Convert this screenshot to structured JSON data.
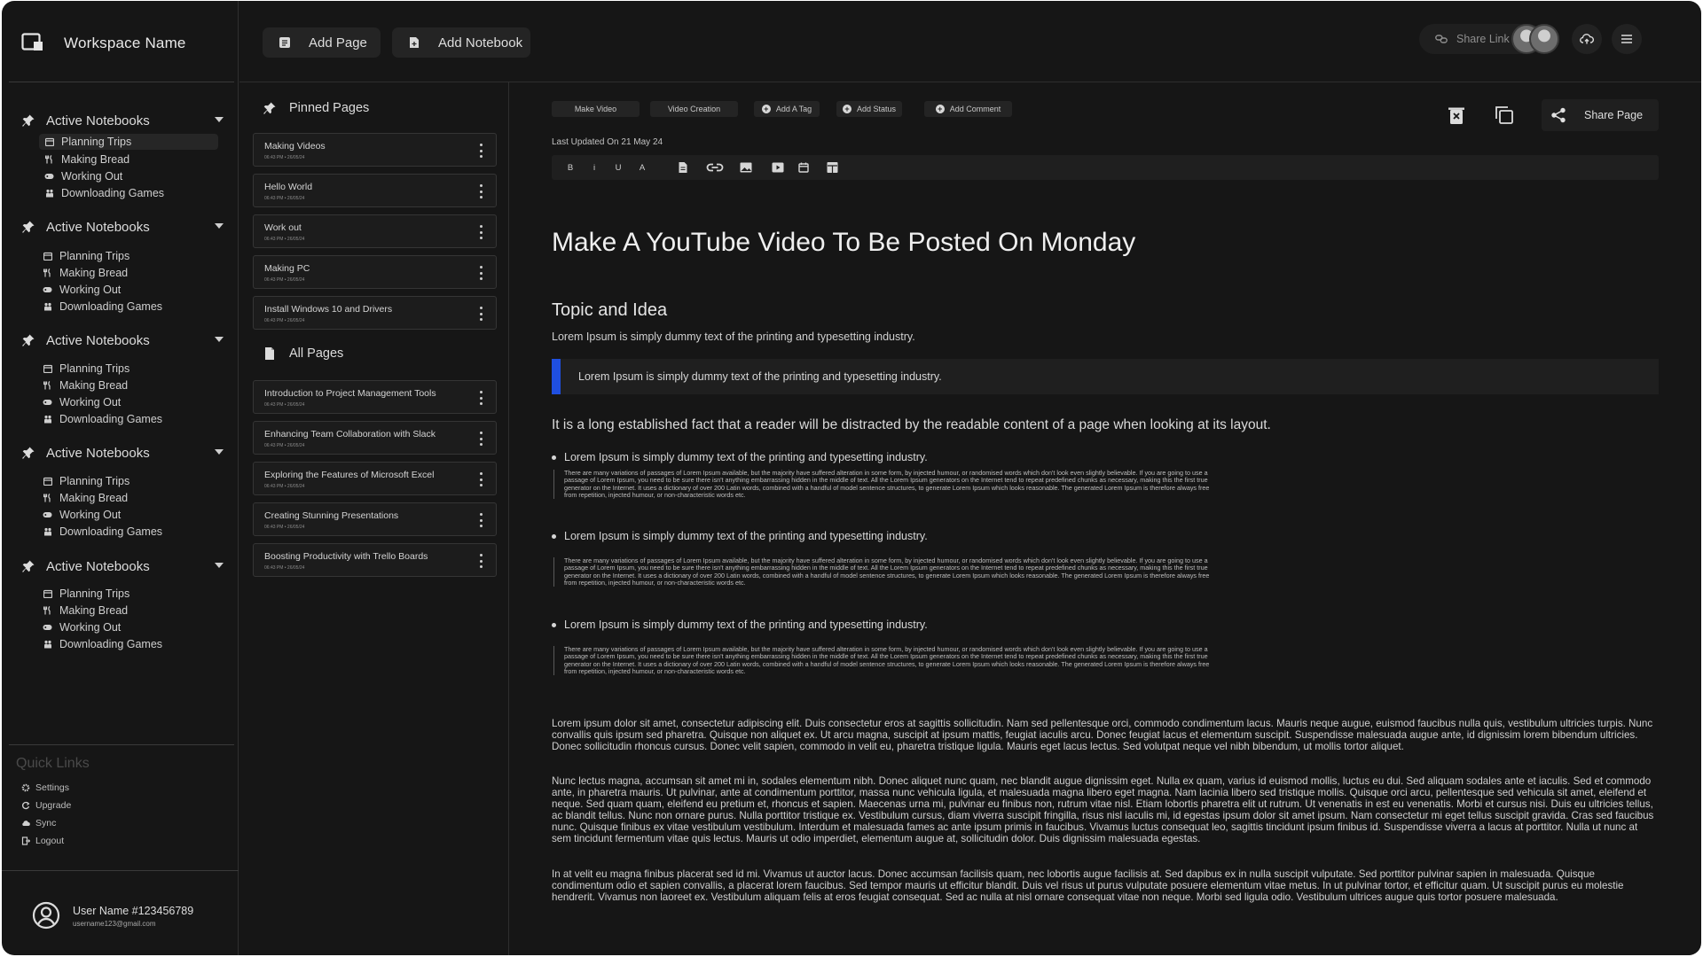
{
  "workspace": {
    "name": "Workspace Name"
  },
  "toolbar": {
    "add_page": "Add Page",
    "add_notebook": "Add Notebook",
    "share_link": "Share Link"
  },
  "sidebar": {
    "groups": [
      {
        "title": "Active Notebooks",
        "items": [
          "Planning Trips",
          "Making Bread",
          "Working Out",
          "Downloading Games"
        ]
      },
      {
        "title": "Active Notebooks",
        "items": [
          "Planning Trips",
          "Making Bread",
          "Working Out",
          "Downloading Games"
        ]
      },
      {
        "title": "Active Notebooks",
        "items": [
          "Planning Trips",
          "Making Bread",
          "Working Out",
          "Downloading Games"
        ]
      },
      {
        "title": "Active Notebooks",
        "items": [
          "Planning Trips",
          "Making Bread",
          "Working Out",
          "Downloading Games"
        ]
      },
      {
        "title": "Active Notebooks",
        "items": [
          "Planning Trips",
          "Making Bread",
          "Working Out",
          "Downloading Games"
        ]
      }
    ],
    "quick_links": {
      "title": "Quick Links",
      "items": [
        "Settings",
        "Upgrade",
        "Sync",
        "Logout"
      ]
    },
    "user": {
      "name": "User Name #123456789",
      "email": "username123@gmail.com"
    }
  },
  "pages": {
    "pinned_title": "Pinned Pages",
    "pinned": [
      {
        "title": "Making Videos",
        "date": "06:43 PM  •  26/05/24"
      },
      {
        "title": "Hello World",
        "date": "06:43 PM  •  26/05/24"
      },
      {
        "title": "Work out",
        "date": "06:43 PM  •  26/05/24"
      },
      {
        "title": "Making PC",
        "date": "06:43 PM  •  26/05/24"
      },
      {
        "title": "Install Windows 10 and Drivers",
        "date": "06:43 PM  •  26/05/24"
      }
    ],
    "all_title": "All Pages",
    "all": [
      {
        "title": "Introduction to Project Management Tools",
        "date": "06:43 PM  •  26/05/24"
      },
      {
        "title": "Enhancing Team Collaboration with Slack",
        "date": "06:43 PM  •  26/05/24"
      },
      {
        "title": "Exploring the Features of Microsoft Excel",
        "date": "06:43 PM  •  26/05/24"
      },
      {
        "title": "Creating Stunning Presentations",
        "date": "06:43 PM  •  26/05/24"
      },
      {
        "title": "Boosting Productivity with Trello Boards",
        "date": "06:43 PM  •  26/05/24"
      }
    ]
  },
  "editor": {
    "tags": [
      "Make Video",
      "Video Creation"
    ],
    "add_tag": "Add A Tag",
    "add_status": "Add Status",
    "add_comment": "Add Comment",
    "share_page": "Share Page",
    "last_updated": "Last Updated On 21 May 24",
    "format": {
      "bold": "B",
      "italic": "i",
      "underline": "U",
      "color": "A"
    },
    "accent": "#1f4fe0"
  },
  "document": {
    "title": "Make A YouTube Video To Be Posted On Monday",
    "heading": "Topic and Idea",
    "intro": "Lorem Ipsum is simply dummy text of the printing and typesetting industry.",
    "quote": "Lorem Ipsum is simply dummy text of the printing and typesetting industry.",
    "lead": "It is a long established fact that a reader will be distracted by the readable content of a page when looking at its layout.",
    "bullets": [
      "Lorem Ipsum is simply dummy text of the printing and typesetting industry.",
      "Lorem Ipsum is simply dummy text of the printing and typesetting industry.",
      "Lorem Ipsum is simply dummy text of the printing and typesetting industry."
    ],
    "small_text": "There are many variations of passages of Lorem Ipsum available, but the majority have suffered alteration in some form, by injected humour, or randomised words which don't look even slightly believable. If you are going to use a passage of Lorem Ipsum, you need to be sure there isn't anything embarrassing hidden in the middle of text. All the Lorem Ipsum generators on the Internet tend to repeat predefined chunks as necessary, making this the first true generator on the Internet. It uses a dictionary of over 200 Latin words, combined with a handful of model sentence structures, to generate Lorem Ipsum which looks reasonable. The generated Lorem Ipsum is therefore always free from repetition, injected humour, or non-characteristic words etc.",
    "paragraphs": [
      "Lorem ipsum dolor sit amet, consectetur adipiscing elit. Duis consectetur eros at sagittis sollicitudin. Nam sed pellentesque orci, commodo condimentum lacus. Mauris neque augue, euismod faucibus nulla quis, vestibulum ultricies turpis. Nunc convallis quis ipsum sed pharetra. Quisque non aliquet ex. Ut arcu magna, suscipit at ipsum mattis, feugiat iaculis arcu. Donec feugiat lacus et elementum suscipit. Suspendisse malesuada augue ante, id dignissim lorem bibendum ultricies. Donec sollicitudin rhoncus cursus. Donec velit sapien, commodo in velit eu, pharetra tristique ligula. Mauris eget lacus lectus. Sed volutpat neque vel nibh bibendum, ut mollis tortor aliquet.",
      "Nunc lectus magna, accumsan sit amet mi in, sodales elementum nibh. Donec aliquet nunc quam, nec blandit augue dignissim eget. Nulla ex quam, varius id euismod mollis, luctus eu dui. Sed aliquam sodales ante et iaculis. Sed et commodo ante, in pharetra mauris. Ut pulvinar, ante at condimentum porttitor, massa nunc vehicula ligula, et malesuada magna libero eget magna. Nam lacinia libero sed tristique mollis. Quisque orci arcu, pellentesque sed vehicula sit amet, eleifend et neque. Sed quam quam, eleifend eu pretium et, rhoncus et sapien. Maecenas urna mi, pulvinar eu finibus non, rutrum vitae nisl. Etiam lobortis pharetra elit ut rutrum. Ut venenatis in est eu venenatis. Morbi et cursus nisi. Duis eu ultricies tellus, ac blandit tellus. Nunc non ornare purus. Nulla porttitor tristique ex. Vestibulum cursus, diam viverra suscipit fringilla, risus nisl iaculis mi, id egestas ipsum dolor sit amet ipsum. Nam consectetur mi eget tellus suscipit gravida. Cras sed faucibus nunc. Quisque finibus ex vitae vestibulum vestibulum. Interdum et malesuada fames ac ante ipsum primis in faucibus. Vivamus luctus consequat leo, sagittis tincidunt ipsum finibus id. Suspendisse viverra a lacus at porttitor. Nulla ut nunc at sem tincidunt fermentum vitae quis lectus. Mauris ut odio imperdiet, elementum augue at, sollicitudin dolor. Duis dignissim malesuada egestas.",
      "In at velit eu magna finibus placerat sed id mi. Vivamus ut auctor lacus. Donec accumsan facilisis quam, nec lobortis augue facilisis at. Sed dapibus ex in nulla suscipit vulputate. Sed porttitor pulvinar sapien in malesuada. Quisque condimentum odio et sapien convallis, a placerat lorem faucibus. Sed tempor mauris ut efficitur blandit. Duis vel risus ut purus vulputate posuere elementum vitae metus. In ut pulvinar tortor, et efficitur quam. Ut suscipit purus eu molestie hendrerit. Vivamus non laoreet ex. Vestibulum aliquam felis at eros feugiat consequat. Sed ac nulla at nisl ornare consequat vitae non neque. Morbi sed ligula odio. Vestibulum ultrices augue quis tortor posuere malesuada."
    ]
  }
}
